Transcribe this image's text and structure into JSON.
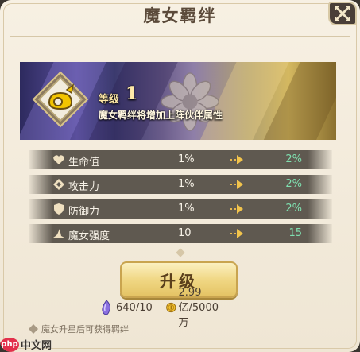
{
  "window": {
    "title": "魔女羁绊"
  },
  "banner": {
    "level_label": "等级",
    "level_value": "1",
    "description": "魔女羁绊将增加上阵伙伴属性"
  },
  "stats": [
    {
      "icon": "heart-icon",
      "name": "生命值",
      "current": "1%",
      "next": "2%"
    },
    {
      "icon": "attack-icon",
      "name": "攻击力",
      "current": "1%",
      "next": "2%"
    },
    {
      "icon": "shield-icon",
      "name": "防御力",
      "current": "1%",
      "next": "2%"
    },
    {
      "icon": "witch-hat-icon",
      "name": "魔女强度",
      "current": "10",
      "next": "15"
    }
  ],
  "upgrade": {
    "label": "升级"
  },
  "costs": [
    {
      "icon": "purple-crystal-icon",
      "value": "640/10"
    },
    {
      "icon": "gold-coin-icon",
      "value": "2.99亿/5000万"
    }
  ],
  "hint": {
    "text": "魔女升星后可获得羁绊"
  },
  "watermark": {
    "logo": "php",
    "text": "中文网"
  },
  "colors": {
    "accent": "#e4c364",
    "next_value": "#7fe0b0",
    "row_bg": "#5f5950"
  }
}
